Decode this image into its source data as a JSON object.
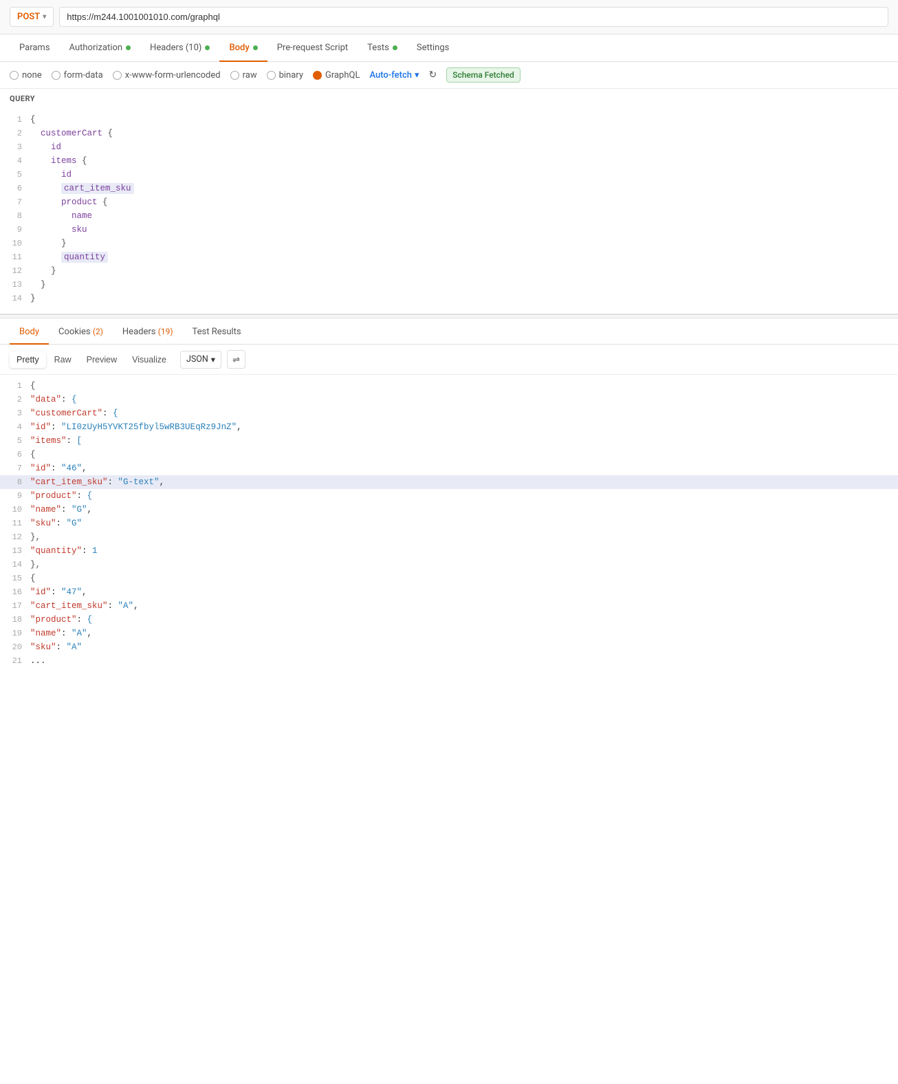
{
  "urlBar": {
    "method": "POST",
    "url": "https://m244.1001001010.com/graphql"
  },
  "tabs": [
    {
      "label": "Params",
      "active": false,
      "dot": null
    },
    {
      "label": "Authorization",
      "active": false,
      "dot": "green"
    },
    {
      "label": "Headers (10)",
      "active": false,
      "dot": "green"
    },
    {
      "label": "Body",
      "active": true,
      "dot": "green"
    },
    {
      "label": "Pre-request Script",
      "active": false,
      "dot": null
    },
    {
      "label": "Tests",
      "active": false,
      "dot": "green"
    },
    {
      "label": "Settings",
      "active": false,
      "dot": null
    }
  ],
  "bodyOptions": {
    "none": "none",
    "formData": "form-data",
    "urlencoded": "x-www-form-urlencoded",
    "raw": "raw",
    "binary": "binary",
    "graphql": "GraphQL",
    "autofetch": "Auto-fetch",
    "schemaStatus": "Schema Fetched"
  },
  "query": {
    "label": "QUERY",
    "lines": [
      {
        "num": 1,
        "indent": 0,
        "content": "{",
        "type": "brace"
      },
      {
        "num": 2,
        "indent": 1,
        "content": "customerCart {",
        "type": "field-brace"
      },
      {
        "num": 3,
        "indent": 2,
        "content": "id",
        "type": "field"
      },
      {
        "num": 4,
        "indent": 2,
        "content": "items {",
        "type": "field-brace"
      },
      {
        "num": 5,
        "indent": 3,
        "content": "id",
        "type": "field"
      },
      {
        "num": 6,
        "indent": 3,
        "content": "cart_item_sku",
        "type": "field-highlight"
      },
      {
        "num": 7,
        "indent": 3,
        "content": "product {",
        "type": "field-brace"
      },
      {
        "num": 8,
        "indent": 4,
        "content": "name",
        "type": "field"
      },
      {
        "num": 9,
        "indent": 4,
        "content": "sku",
        "type": "field"
      },
      {
        "num": 10,
        "indent": 3,
        "content": "}",
        "type": "brace"
      },
      {
        "num": 11,
        "indent": 3,
        "content": "quantity",
        "type": "field-highlight"
      },
      {
        "num": 12,
        "indent": 2,
        "content": "}",
        "type": "brace"
      },
      {
        "num": 13,
        "indent": 1,
        "content": "}",
        "type": "brace"
      },
      {
        "num": 14,
        "indent": 0,
        "content": "}",
        "type": "brace"
      }
    ]
  },
  "responseTabs": [
    {
      "label": "Body",
      "active": true,
      "count": null
    },
    {
      "label": "Cookies (2)",
      "active": false,
      "count": 2
    },
    {
      "label": "Headers (19)",
      "active": false,
      "count": 19
    },
    {
      "label": "Test Results",
      "active": false,
      "count": null
    }
  ],
  "responseToolbar": {
    "formats": [
      "Pretty",
      "Raw",
      "Preview",
      "Visualize"
    ],
    "activeFormat": "Pretty",
    "jsonLabel": "JSON",
    "wrapIcon": "≡→"
  },
  "responseLines": [
    {
      "num": 1,
      "content": "{"
    },
    {
      "num": 2,
      "content": "    \"data\": {"
    },
    {
      "num": 3,
      "content": "        \"customerCart\": {"
    },
    {
      "num": 4,
      "content": "            \"id\": \"LI0zUyH5YVKT25fbyl5wRB3UEqRz9JnZ\","
    },
    {
      "num": 5,
      "content": "            \"items\": ["
    },
    {
      "num": 6,
      "content": "                {"
    },
    {
      "num": 7,
      "content": "                    \"id\": \"46\","
    },
    {
      "num": 8,
      "content": "                    \"cart_item_sku\": \"G-text\",",
      "highlight": true
    },
    {
      "num": 9,
      "content": "                    \"product\": {"
    },
    {
      "num": 10,
      "content": "                        \"name\": \"G\","
    },
    {
      "num": 11,
      "content": "                        \"sku\": \"G\""
    },
    {
      "num": 12,
      "content": "                    },"
    },
    {
      "num": 13,
      "content": "                    \"quantity\": 1"
    },
    {
      "num": 14,
      "content": "                },"
    },
    {
      "num": 15,
      "content": "                {"
    },
    {
      "num": 16,
      "content": "                    \"id\": \"47\","
    },
    {
      "num": 17,
      "content": "                    \"cart_item_sku\": \"A\","
    },
    {
      "num": 18,
      "content": "                    \"product\": {"
    },
    {
      "num": 19,
      "content": "                        \"name\": \"A\","
    },
    {
      "num": 20,
      "content": "                        \"sku\": \"A\""
    },
    {
      "num": 21,
      "content": "                ..."
    }
  ]
}
